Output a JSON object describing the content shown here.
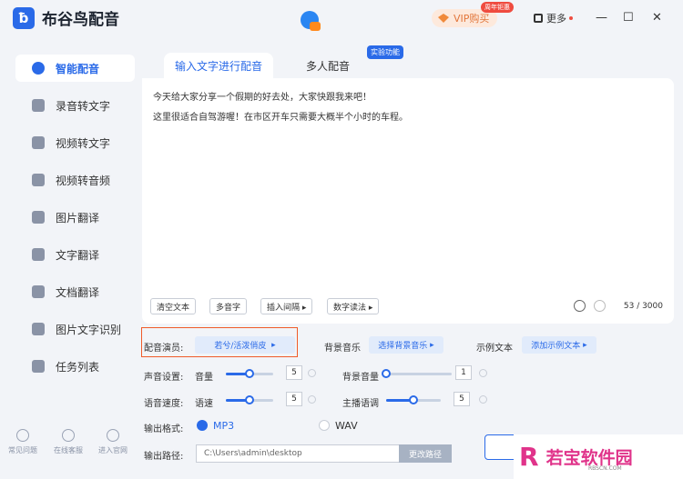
{
  "app": {
    "title": "布谷鸟配音"
  },
  "titlebar": {
    "vip_label": "VIP购买",
    "vip_badge": "周年钜惠",
    "more_label": "更多",
    "minimize": "—",
    "maximize": "☐",
    "close": "✕"
  },
  "sidebar": {
    "items": [
      {
        "label": "智能配音",
        "icon": "mic-icon",
        "active": true
      },
      {
        "label": "录音转文字",
        "icon": "audio-text-icon"
      },
      {
        "label": "视频转文字",
        "icon": "video-text-icon"
      },
      {
        "label": "视频转音频",
        "icon": "video-audio-icon"
      },
      {
        "label": "图片翻译",
        "icon": "image-translate-icon"
      },
      {
        "label": "文字翻译",
        "icon": "text-translate-icon"
      },
      {
        "label": "文档翻译",
        "icon": "doc-translate-icon"
      },
      {
        "label": "图片文字识别",
        "icon": "ocr-icon"
      },
      {
        "label": "任务列表",
        "icon": "task-list-icon"
      }
    ],
    "footer": [
      {
        "label": "常见问题"
      },
      {
        "label": "在线客服"
      },
      {
        "label": "进入官网"
      }
    ]
  },
  "tabs": [
    {
      "label": "输入文字进行配音"
    },
    {
      "label": "多人配音"
    }
  ],
  "lab_badge": "实验功能",
  "editor": {
    "lines": [
      "今天给大家分享一个假期的好去处，大家快跟我来吧！",
      "这里很适合自驾游喔！在市区开车只需要大概半个小时的车程。"
    ],
    "buttons": [
      "清空文本",
      "多音字",
      "插入间隔 ▸",
      "数字读法 ▸"
    ],
    "char_count": "53 / 3000"
  },
  "settings": {
    "voice_label": "配音演员:",
    "voice_value": "若兮/活泼俏皮",
    "bgm_label": "背景音乐",
    "bgm_value": "选择背景音乐",
    "sample_label": "示例文本",
    "sample_value": "添加示例文本",
    "sound_label": "声音设置:",
    "volume_label": "音量",
    "volume_value": "5",
    "volume_level": 0.5,
    "bg_volume_label": "背景音量",
    "bg_volume_value": "1",
    "bg_volume_level": 0.0,
    "speed_section_label": "语音速度:",
    "speed_label": "语速",
    "speed_value": "5",
    "speed_level": 0.5,
    "pitch_label": "主播语调",
    "pitch_value": "5",
    "pitch_level": 0.5,
    "format_label": "输出格式:",
    "format_mp3": "MP3",
    "format_wav": "WAV",
    "path_label": "输出路径:",
    "path_value": "C:\\Users\\admin\\desktop",
    "path_button": "更改路径"
  },
  "watermark": {
    "logo": "R",
    "text": "若宝软件园",
    "sub": "RBSCN.COM"
  },
  "colors": {
    "accent": "#2a6ae8",
    "highlight": "#f05b2a",
    "vip": "#e2763b"
  }
}
